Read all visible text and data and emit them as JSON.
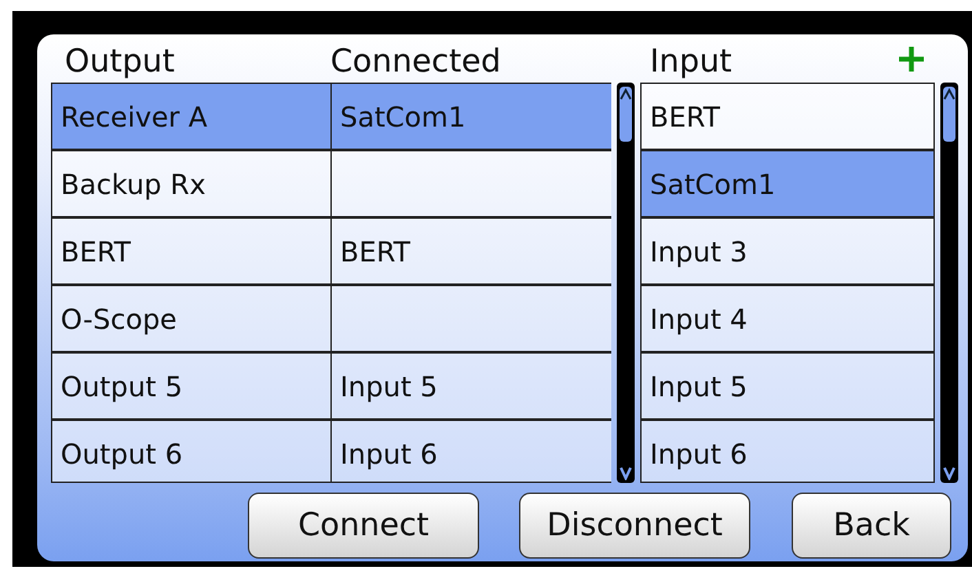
{
  "routing_table": {
    "columns": [
      "Output",
      "Connected"
    ],
    "rows": [
      {
        "output": "Receiver A",
        "connected": "SatCom1",
        "selected": true
      },
      {
        "output": "Backup Rx",
        "connected": "",
        "selected": false
      },
      {
        "output": "BERT",
        "connected": "BERT",
        "selected": false
      },
      {
        "output": "O-Scope",
        "connected": "",
        "selected": false
      },
      {
        "output": "Output 5",
        "connected": "Input 5",
        "selected": false
      },
      {
        "output": "Output 6",
        "connected": "Input 6",
        "selected": false
      }
    ]
  },
  "input_list": {
    "title": "Input",
    "items": [
      {
        "label": "BERT",
        "selected": false
      },
      {
        "label": "SatCom1",
        "selected": true
      },
      {
        "label": "Input 3",
        "selected": false
      },
      {
        "label": "Input 4",
        "selected": false
      },
      {
        "label": "Input 5",
        "selected": false
      },
      {
        "label": "Input 6",
        "selected": false
      }
    ]
  },
  "buttons": [
    "Connect",
    "Disconnect",
    "Back"
  ]
}
